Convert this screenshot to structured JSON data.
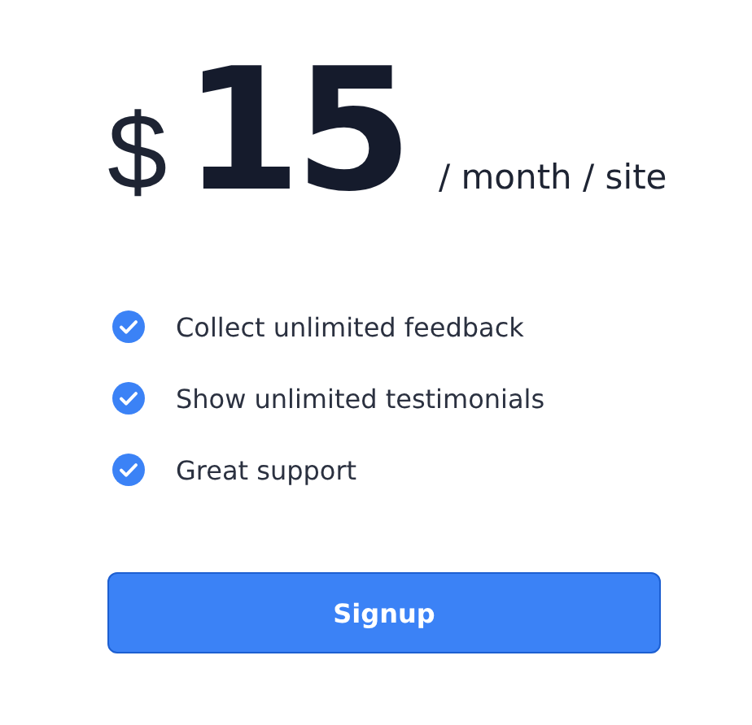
{
  "price": {
    "currency": "$",
    "amount": "15",
    "period": "/ month / site"
  },
  "features": [
    {
      "label": "Collect unlimited feedback"
    },
    {
      "label": "Show unlimited testimonials"
    },
    {
      "label": "Great support"
    }
  ],
  "button": {
    "label": "Signup"
  }
}
